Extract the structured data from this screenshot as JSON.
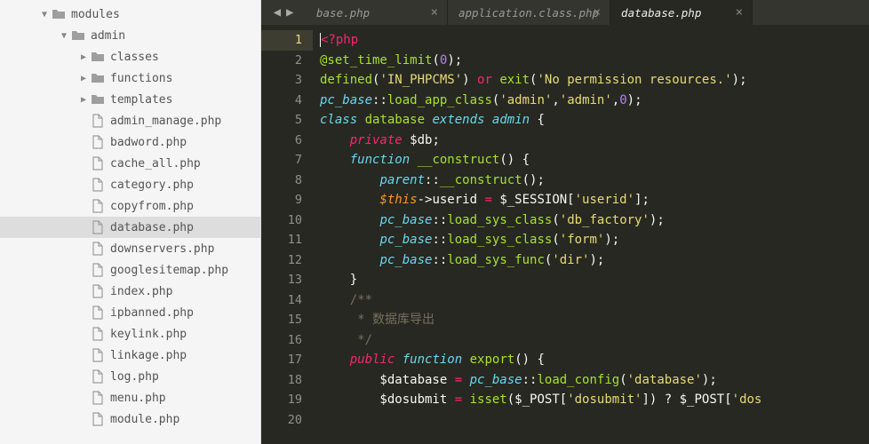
{
  "sidebar": {
    "root": {
      "name": "modules",
      "type": "folder",
      "open": true,
      "indent": 44
    },
    "child": {
      "name": "admin",
      "type": "folder",
      "open": true,
      "indent": 66
    },
    "subfolders": [
      {
        "name": "classes",
        "type": "folder",
        "open": false
      },
      {
        "name": "functions",
        "type": "folder",
        "open": false
      },
      {
        "name": "templates",
        "type": "folder",
        "open": false
      }
    ],
    "files": [
      {
        "name": "admin_manage.php"
      },
      {
        "name": "badword.php"
      },
      {
        "name": "cache_all.php"
      },
      {
        "name": "category.php"
      },
      {
        "name": "copyfrom.php"
      },
      {
        "name": "database.php",
        "selected": true
      },
      {
        "name": "downservers.php"
      },
      {
        "name": "googlesitemap.php"
      },
      {
        "name": "index.php"
      },
      {
        "name": "ipbanned.php"
      },
      {
        "name": "keylink.php"
      },
      {
        "name": "linkage.php"
      },
      {
        "name": "log.php"
      },
      {
        "name": "menu.php"
      },
      {
        "name": "module.php"
      }
    ]
  },
  "tabs": [
    {
      "label": "base.php",
      "active": false
    },
    {
      "label": "application.class.php",
      "active": false
    },
    {
      "label": "database.php",
      "active": true
    }
  ],
  "code": {
    "lines": [
      {
        "n": 1,
        "html": "<span class='cursor'></span><span class='c-tag'>&lt;?php</span>"
      },
      {
        "n": 2,
        "html": "<span class='c-fn'>@set_time_limit</span>(<span class='c-num'>0</span>);"
      },
      {
        "n": 3,
        "html": "<span class='c-fn'>defined</span>(<span class='c-str'>'IN_PHPCMS'</span>) <span class='c-op'>or</span> <span class='c-fn'>exit</span>(<span class='c-str'>'No permission resources.'</span>);"
      },
      {
        "n": 4,
        "html": "<span class='c-type'>pc_base</span>::<span class='c-fn'>load_app_class</span>(<span class='c-str'>'admin'</span>,<span class='c-str'>'admin'</span>,<span class='c-num'>0</span>);"
      },
      {
        "n": 5,
        "html": ""
      },
      {
        "n": 6,
        "html": "<span class='c-kw2'>class</span> <span class='c-fn'>database</span> <span class='c-kw2'>extends</span> <span class='c-fn c-type'>admin</span> {"
      },
      {
        "n": 7,
        "html": "    <span class='c-kw'>private</span> <span class='c-def'>$db</span>;"
      },
      {
        "n": 8,
        "html": "    <span class='c-kw2'>function</span> <span class='c-fn'>__construct</span>() {"
      },
      {
        "n": 9,
        "html": "        <span class='c-type'>parent</span>::<span class='c-fn'>__construct</span>();"
      },
      {
        "n": 10,
        "html": "        <span class='c-var'>$this</span>-&gt;userid <span class='c-op'>=</span> $_SESSION[<span class='c-str'>'userid'</span>];"
      },
      {
        "n": 11,
        "html": "        <span class='c-type'>pc_base</span>::<span class='c-fn'>load_sys_class</span>(<span class='c-str'>'db_factory'</span>);"
      },
      {
        "n": 12,
        "html": "        <span class='c-type'>pc_base</span>::<span class='c-fn'>load_sys_class</span>(<span class='c-str'>'form'</span>);"
      },
      {
        "n": 13,
        "html": "        <span class='c-type'>pc_base</span>::<span class='c-fn'>load_sys_func</span>(<span class='c-str'>'dir'</span>);"
      },
      {
        "n": 14,
        "html": "    }"
      },
      {
        "n": 15,
        "html": "    <span class='c-com'>/**</span>"
      },
      {
        "n": 16,
        "html": "    <span class='c-com'> * 数据库导出</span>"
      },
      {
        "n": 17,
        "html": "    <span class='c-com'> */</span>"
      },
      {
        "n": 18,
        "html": "    <span class='c-kw'>public</span> <span class='c-kw2'>function</span> <span class='c-fn'>export</span>() {"
      },
      {
        "n": 19,
        "html": "        $database <span class='c-op'>=</span> <span class='c-type'>pc_base</span>::<span class='c-fn'>load_config</span>(<span class='c-str'>'database'</span>);"
      },
      {
        "n": 20,
        "html": "        $dosubmit <span class='c-op'>=</span> <span class='c-fn'>isset</span>($_POST[<span class='c-str'>'dosubmit'</span>]) ? $_POST[<span class='c-str'>'dos</span>"
      }
    ],
    "current_line": 1
  }
}
